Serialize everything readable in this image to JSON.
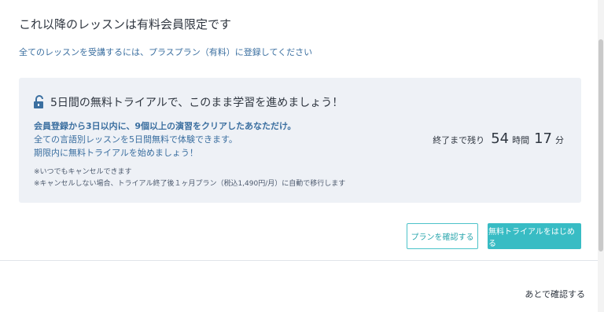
{
  "modal": {
    "title": "これ以降のレッスンは有料会員限定です",
    "subtitle": "全てのレッスンを受講するには、プラスプラン（有料）に登録してください"
  },
  "trial": {
    "heading": "5日間の無料トライアルで、このまま学習を進めましょう！",
    "condition": "会員登録から3日以内に、9個以上の演習をクリアしたあなただけ。",
    "line2": "全ての言語別レッスンを5日間無料で体験できます。",
    "line3": "期限内に無料トライアルを始めましょう！",
    "note1": "※いつでもキャンセルできます",
    "note2": "※キャンセルしない場合、トライアル終了後１ヶ月プラン（税込1,490円/月）に自動で移行します",
    "lock_icon": "unlocked-padlock-icon"
  },
  "countdown": {
    "label": "終了まで残り",
    "hours": "54",
    "hours_unit": "時間",
    "minutes": "17",
    "minutes_unit": "分"
  },
  "buttons": {
    "view_plan": "プランを確認する",
    "start_trial": "無料トライアルをはじめる"
  },
  "footer": {
    "later": "あとで確認する"
  },
  "colors": {
    "accent": "#38bcc4",
    "link_blue": "#3b6fa0",
    "panel_bg": "#eef1f6"
  }
}
